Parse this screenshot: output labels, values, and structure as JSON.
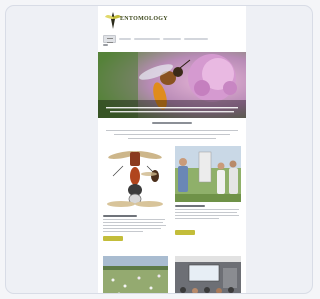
{
  "colors": {
    "accent_button": "#c3bd3a",
    "logo_text": "#3f4a1e",
    "frame_bg": "#eef0f5"
  },
  "header": {
    "logo_name": "ENTOMOLOGY",
    "logo_icon": "bee-logo-icon",
    "nav": {
      "home_icon": "menu-icon"
    }
  },
  "hero": {
    "image_icon": "bee-on-flower-photo"
  },
  "columns": {
    "left": {
      "image_icon": "insect-illustration"
    },
    "right": {
      "image_icon": "people-outdoor-photo"
    }
  },
  "bottom": {
    "left": {
      "image_icon": "meadow-photo"
    },
    "right": {
      "image_icon": "conference-room-photo"
    }
  }
}
